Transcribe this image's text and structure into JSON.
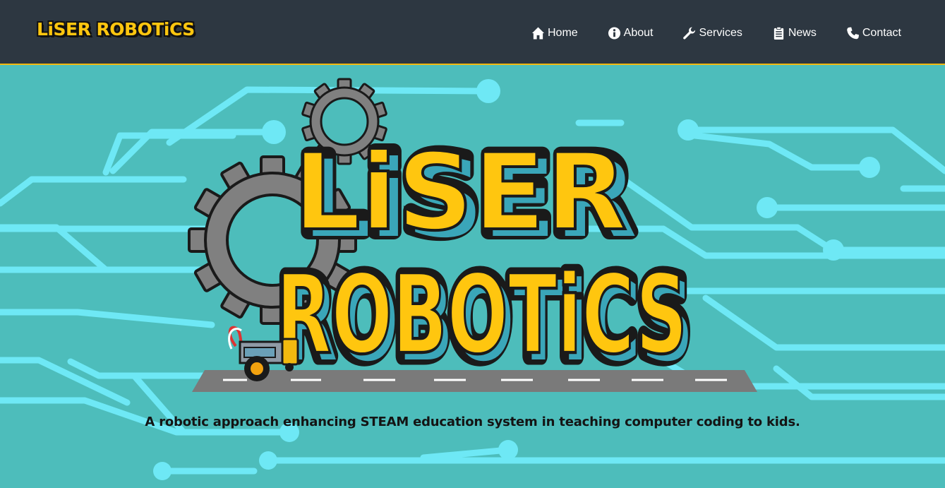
{
  "header": {
    "brand": "LiSER ROBOTiCS",
    "nav": [
      {
        "label": "Home",
        "icon": "home-icon"
      },
      {
        "label": "About",
        "icon": "info-icon"
      },
      {
        "label": "Services",
        "icon": "wrench-icon"
      },
      {
        "label": "News",
        "icon": "clipboard-icon"
      },
      {
        "label": "Contact",
        "icon": "phone-icon"
      }
    ]
  },
  "hero": {
    "logo_line1": "LiSER",
    "logo_line2": "ROBOTiCS",
    "tagline": "A robotic approach enhancing STEAM education system in teaching computer coding to kids."
  },
  "colors": {
    "header_bg": "#2d3741",
    "accent": "#f2b90f",
    "hero_bg": "#4dbdbb",
    "circuit": "#6ee8f5",
    "logo_yellow": "#ffc60f",
    "gear": "#808080"
  }
}
